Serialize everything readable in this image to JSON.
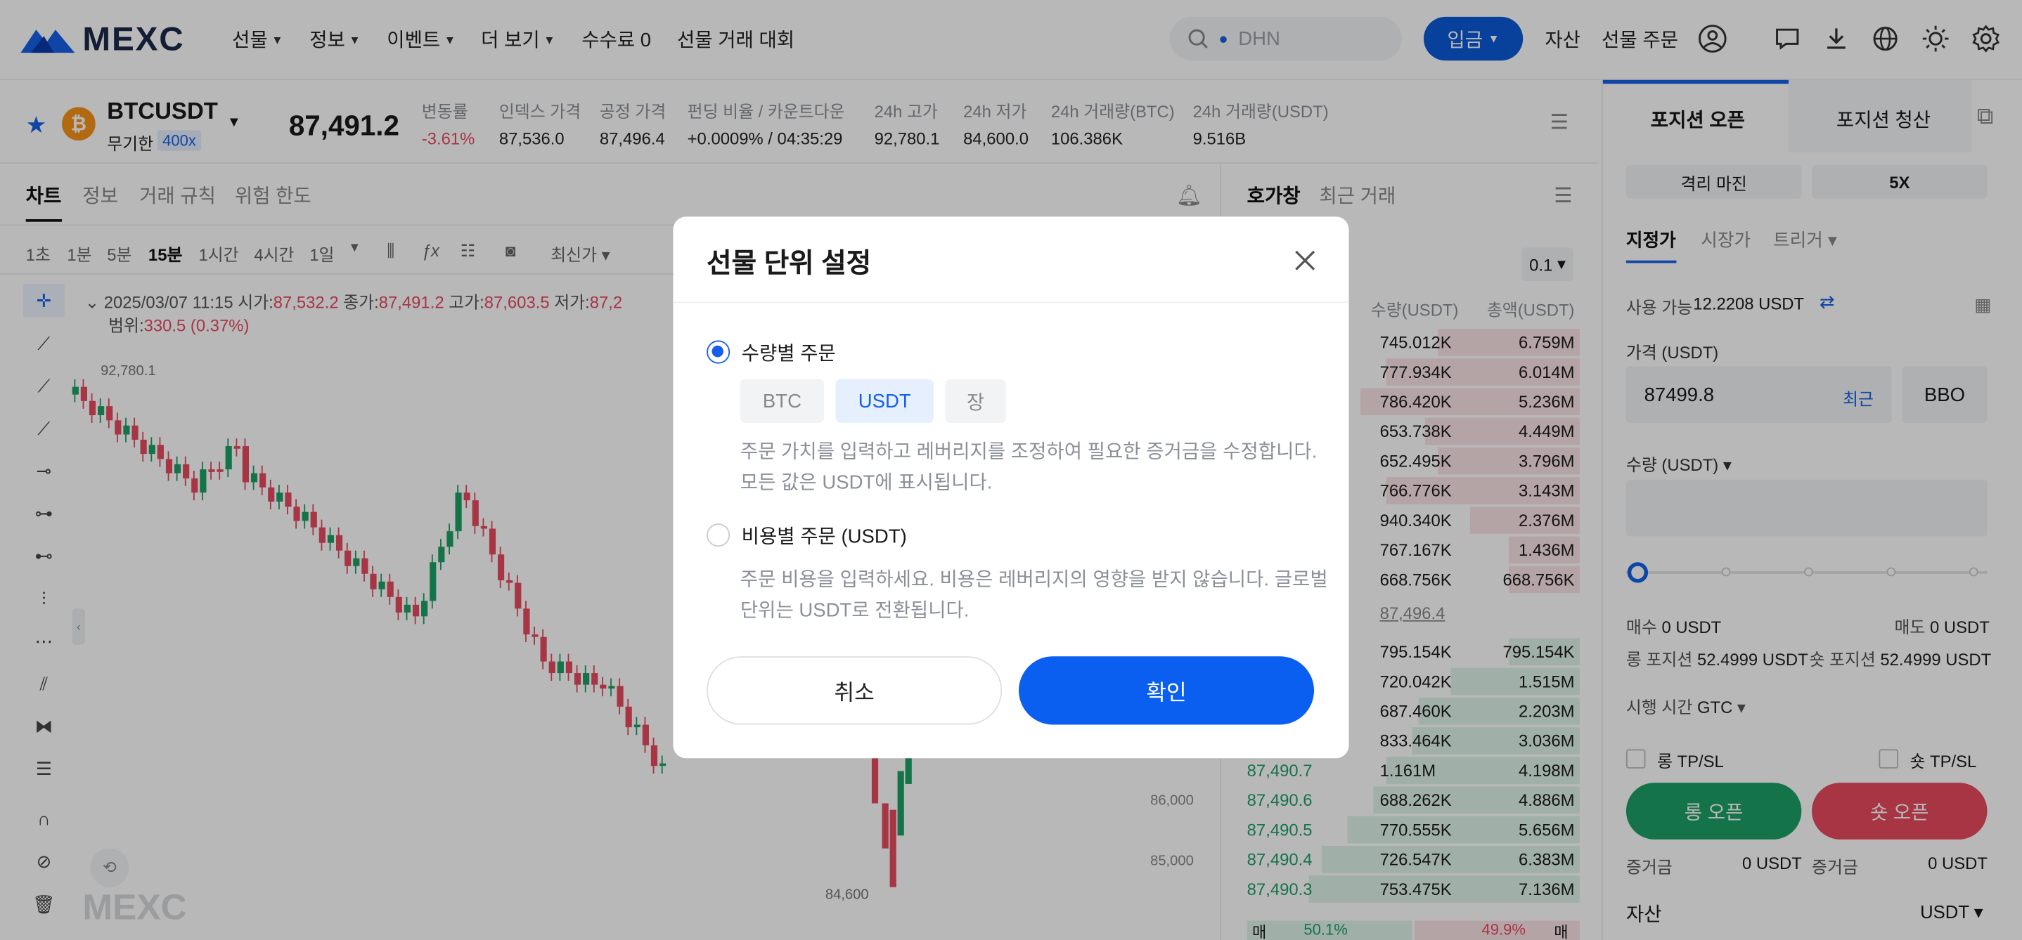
{
  "header": {
    "logo": "MEXC",
    "nav": [
      "선물",
      "정보",
      "이벤트",
      "더 보기"
    ],
    "fee": "수수료 0",
    "contest": "선물 거래 대회",
    "search_value": "DHN",
    "deposit": "입금",
    "assets": "자산",
    "futures_orders": "선물 주문"
  },
  "ticker": {
    "symbol": "BTCUSDT",
    "type": "무기한",
    "leverage": "400x",
    "price": "87,491.2",
    "stats": [
      {
        "label": "변동률",
        "value": "-3.61%"
      },
      {
        "label": "인덱스 가격",
        "value": "87,536.0"
      },
      {
        "label": "공정 가격",
        "value": "87,496.4"
      },
      {
        "label": "펀딩 비율 / 카운트다운",
        "value": "+0.0009% / 04:35:29"
      },
      {
        "label": "24h 고가",
        "value": "92,780.1"
      },
      {
        "label": "24h 저가",
        "value": "84,600.0"
      },
      {
        "label": "24h 거래량(BTC)",
        "value": "106.386K"
      },
      {
        "label": "24h 거래량(USDT)",
        "value": "9.516B"
      }
    ]
  },
  "chart": {
    "tabs": [
      "차트",
      "정보",
      "거래 규칙",
      "위험 한도"
    ],
    "intervals": [
      "1초",
      "1분",
      "5분",
      "15분",
      "1시간",
      "4시간",
      "1일"
    ],
    "price_type": "최신가",
    "ohlc": {
      "date": "2025/03/07 11:15",
      "open_label": "시가:",
      "open": "87,532.2",
      "close_label": "종가:",
      "close": "87,491.2",
      "high_label": "고가:",
      "high": "87,603.5",
      "low_label": "저가:",
      "low": "87,2",
      "range_label": "범위:",
      "range": "330.5 (0.37%)"
    },
    "high_mark": "92,780.1",
    "low_mark": "84,600",
    "axis": [
      "86,000",
      "85,000"
    ],
    "watermark": "MEXC"
  },
  "orderbook": {
    "tabs": [
      "호가창",
      "최근 거래"
    ],
    "precision": "0.1",
    "col_qty": "수량(USDT)",
    "col_total": "총액(USDT)",
    "asks": [
      [
        "745.012K",
        "6.759M"
      ],
      [
        "777.934K",
        "6.014M"
      ],
      [
        "786.420K",
        "5.236M"
      ],
      [
        "653.738K",
        "4.449M"
      ],
      [
        "652.495K",
        "3.796M"
      ],
      [
        "766.776K",
        "3.143M"
      ],
      [
        "940.340K",
        "2.376M"
      ],
      [
        "767.167K",
        "1.436M"
      ],
      [
        "668.756K",
        "668.756K"
      ]
    ],
    "mid": "87,496.4",
    "bids": [
      [
        "",
        "795.154K",
        "795.154K"
      ],
      [
        "",
        "720.042K",
        "1.515M"
      ],
      [
        "",
        "687.460K",
        "2.203M"
      ],
      [
        "",
        "833.464K",
        "3.036M"
      ],
      [
        "87,490.7",
        "1.161M",
        "4.198M"
      ],
      [
        "87,490.6",
        "688.262K",
        "4.886M"
      ],
      [
        "87,490.5",
        "770.555K",
        "5.656M"
      ],
      [
        "87,490.4",
        "726.547K",
        "6.383M"
      ],
      [
        "87,490.3",
        "753.475K",
        "7.136M"
      ]
    ],
    "buy_label": "매",
    "buy_pct": "50.1%",
    "sell_pct": "49.9%",
    "sell_label": "매"
  },
  "panel": {
    "tab_open": "포지션 오픈",
    "tab_close": "포지션 청산",
    "margin_mode": "격리 마진",
    "lev": "5X",
    "order_types": [
      "지정가",
      "시장가",
      "트리거"
    ],
    "available_label": "사용 가능",
    "available": "12.2208 USDT",
    "price_label": "가격 (USDT)",
    "price_value": "87499.8",
    "recent": "최근",
    "bbo": "BBO",
    "qty_label": "수량 (USDT)",
    "buy_label": "매수",
    "buy_val": "0 USDT",
    "sell_label": "매도",
    "sell_val": "0 USDT",
    "long_label": "롱 포지션",
    "long_val": "52.4999 USDT",
    "short_label": "숏 포지션",
    "short_val": "52.4999 USDT",
    "tif_label": "시행 시간",
    "tif": "GTC",
    "long_tpsl": "롱 TP/SL",
    "short_tpsl": "숏 TP/SL",
    "long_open": "롱 오픈",
    "short_open": "숏 오픈",
    "margin_label": "증거금",
    "margin_long": "0 USDT",
    "margin_short": "0 USDT",
    "assets": "자산",
    "asset_ccy": "USDT"
  },
  "modal": {
    "title": "선물 단위 설정",
    "opt1": "수량별 주문",
    "chips": [
      "BTC",
      "USDT",
      "장"
    ],
    "desc1a": "주문 가치를 입력하고 레버리지를 조정하여 필요한 증거금을 수정합니다.",
    "desc1b": "모든 값은 USDT에 표시됩니다.",
    "opt2": "비용별 주문 (USDT)",
    "desc2a": "주문 비용을 입력하세요. 비용은 레버리지의 영향을 받지 않습니다. 글로벌",
    "desc2b": "단위는 USDT로 전환됩니다.",
    "cancel": "취소",
    "confirm": "확인"
  },
  "colors": {
    "brand": "#0a5ad8",
    "up": "#1ea067",
    "down": "#e84a5f",
    "confirm": "#0a5ff0"
  }
}
